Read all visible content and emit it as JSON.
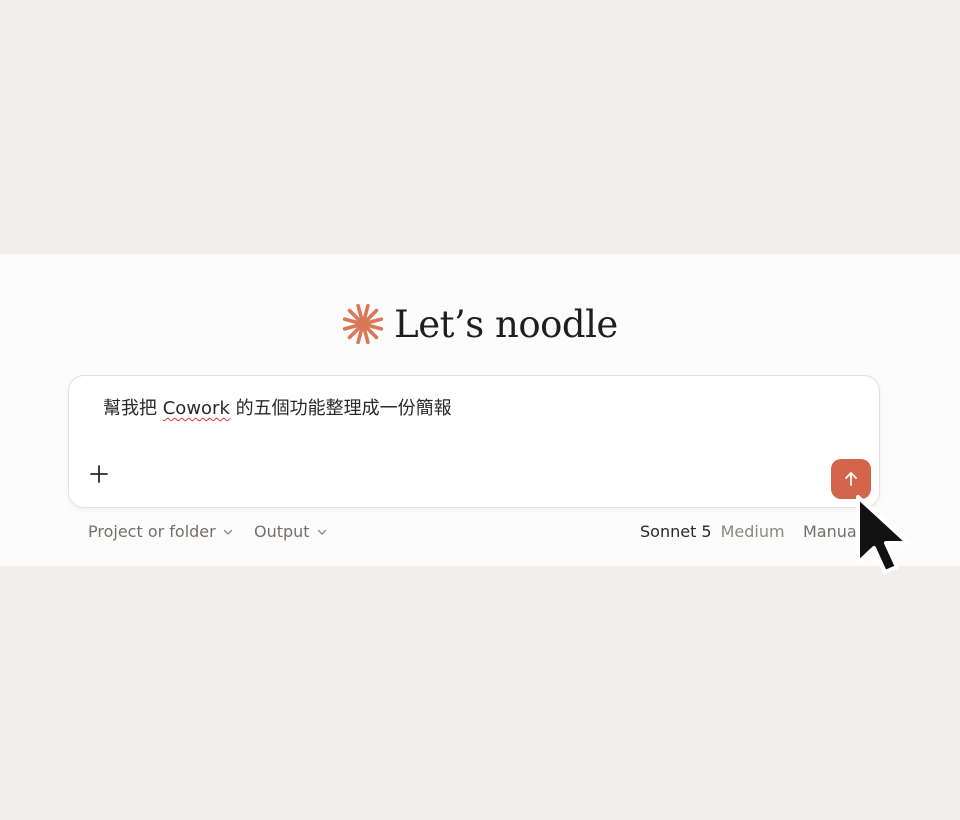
{
  "greeting": {
    "title": "Let’s noodle",
    "icon": "starburst-icon"
  },
  "composer": {
    "prompt_before": "幫我把 ",
    "prompt_misspelled": "Cowork",
    "prompt_after": " 的五個功能整理成一份簡報",
    "add_icon": "plus-icon",
    "send_icon": "arrow-up-icon"
  },
  "toolbar": {
    "project_label": "Project or folder",
    "output_label": "Output",
    "model_name": "Sonnet 5",
    "model_effort": "Medium",
    "mode_label": "Manua"
  },
  "colors": {
    "accent": "#d3654b",
    "brand_icon": "#d97757",
    "page_background": "#f3eeee",
    "panel_background": "#fdfcfc"
  }
}
